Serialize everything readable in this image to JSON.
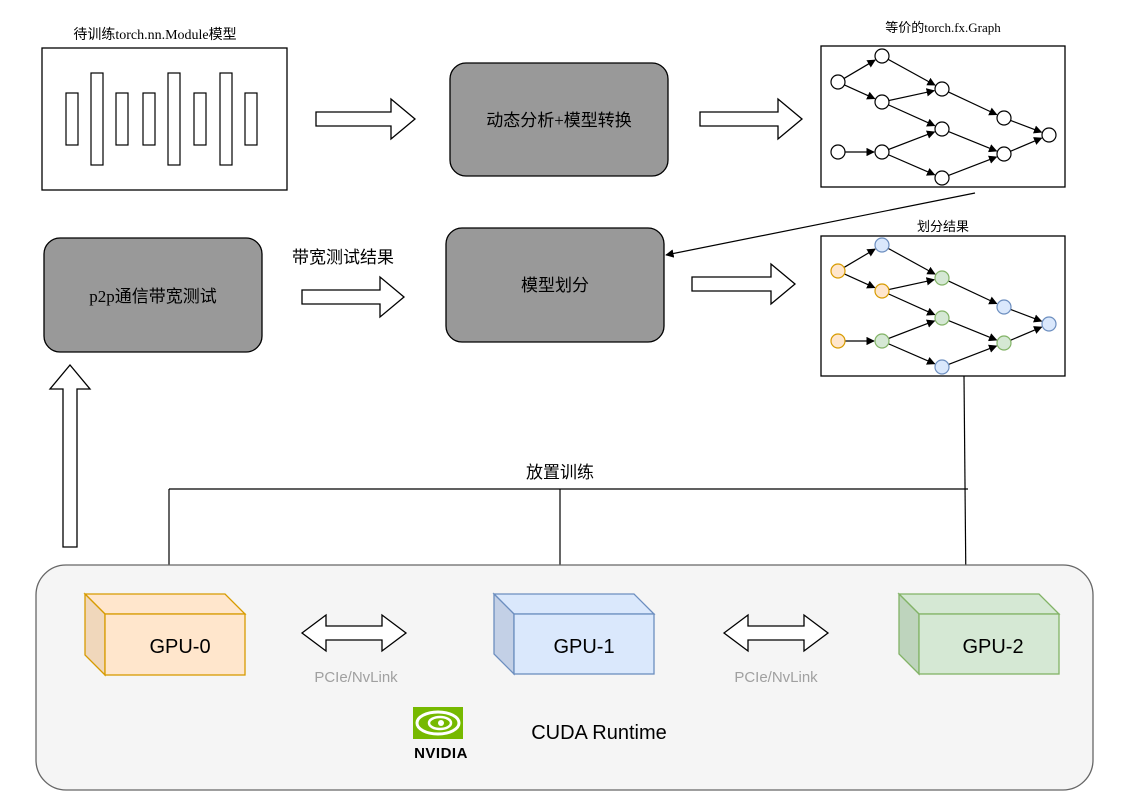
{
  "labels": {
    "module_title": "待训练torch.nn.Module模型",
    "analysis_box": "动态分析+模型转换",
    "graph_title": "等价的torch.fx.Graph",
    "p2p_box": "p2p通信带宽测试",
    "bandwidth_label": "带宽测试结果",
    "partition_box": "模型划分",
    "partition_title": "划分结果",
    "placement_label": "放置训练",
    "gpu0": "GPU-0",
    "gpu1": "GPU-1",
    "gpu2": "GPU-2",
    "link_left": "PCIe/NvLink",
    "link_right": "PCIe/NvLink",
    "runtime_label": "CUDA Runtime",
    "nvidia_logo": "NVIDIA"
  },
  "colors": {
    "gray_box": "#999999",
    "gpu0_fill": "#ffe6cc",
    "gpu0_stroke": "#d79b00",
    "gpu1_fill": "#dae8fc",
    "gpu1_stroke": "#6c8ebf",
    "gpu2_fill": "#d5e8d4",
    "gpu2_stroke": "#82b366",
    "runtime_fill": "#f5f5f5",
    "nvidia_green": "#76b900"
  },
  "graph_nodes": [
    {
      "id": "n1",
      "color": "orange"
    },
    {
      "id": "n2",
      "color": "blue"
    },
    {
      "id": "n3",
      "color": "orange"
    },
    {
      "id": "n4",
      "color": "green"
    },
    {
      "id": "n5",
      "color": "green"
    },
    {
      "id": "n6",
      "color": "blue"
    },
    {
      "id": "n7",
      "color": "blue"
    },
    {
      "id": "n8",
      "color": "orange"
    },
    {
      "id": "n9",
      "color": "green"
    },
    {
      "id": "n10",
      "color": "blue"
    },
    {
      "id": "n11",
      "color": "green"
    }
  ],
  "graph_edges": [
    [
      "n1",
      "n2"
    ],
    [
      "n1",
      "n3"
    ],
    [
      "n2",
      "n4"
    ],
    [
      "n3",
      "n4"
    ],
    [
      "n3",
      "n5"
    ],
    [
      "n4",
      "n6"
    ],
    [
      "n6",
      "n7"
    ],
    [
      "n8",
      "n9"
    ],
    [
      "n9",
      "n5"
    ],
    [
      "n9",
      "n10"
    ],
    [
      "n5",
      "n11"
    ],
    [
      "n10",
      "n11"
    ],
    [
      "n11",
      "n7"
    ]
  ]
}
